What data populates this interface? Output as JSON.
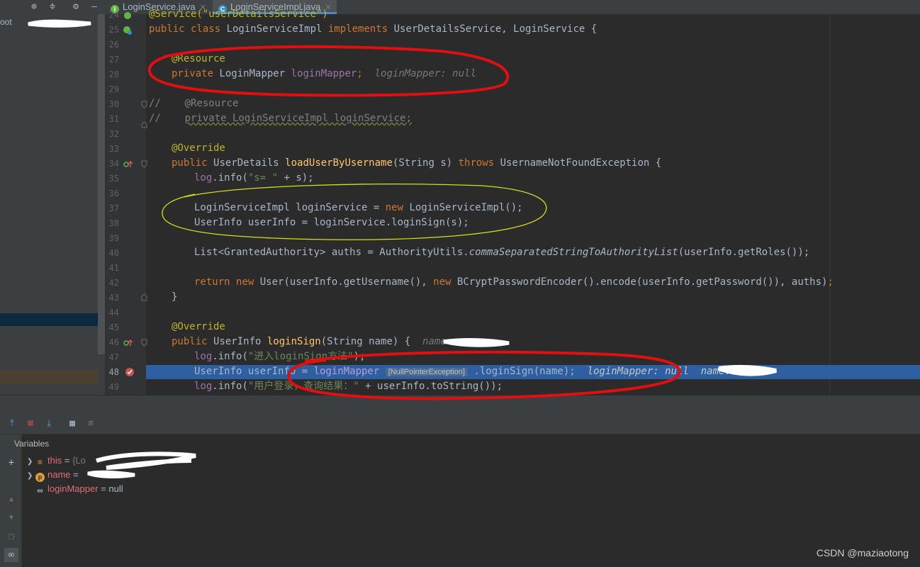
{
  "project_panel": {
    "root_label": "oot"
  },
  "tabs": [
    {
      "label": "LoginService.java",
      "icon_letter": "I",
      "icon_color": "#62b543"
    },
    {
      "label": "LoginServiceImpl.java",
      "icon_letter": "C",
      "icon_color": "#3592c4"
    }
  ],
  "line_numbers": [
    "24",
    "25",
    "26",
    "27",
    "28",
    "29",
    "30",
    "31",
    "32",
    "33",
    "34",
    "35",
    "36",
    "37",
    "38",
    "39",
    "40",
    "41",
    "42",
    "43",
    "44",
    "45",
    "46",
    "47",
    "48",
    "49"
  ],
  "code": {
    "l24": "@Service(\"userDetailsService\")",
    "l25_a": "public class ",
    "l25_b": "LoginServiceImpl ",
    "l25_c": "implements ",
    "l25_d": "UserDetailsService, LoginService {",
    "l27": "@Resource",
    "l28_kw": "private ",
    "l28_type": "LoginMapper ",
    "l28_field": "loginMapper",
    "l28_semi": ";",
    "l28_hint": "loginMapper: null",
    "l30_a": "//",
    "l30_b": "@Resource",
    "l31_a": "//",
    "l31_b": "private LoginServiceImpl loginService;",
    "l33": "@Override",
    "l34_a": "public ",
    "l34_b": "UserDetails ",
    "l34_c": "loadUserByUsername",
    "l34_d": "(String s) ",
    "l34_e": "throws ",
    "l34_f": "UsernameNotFoundException {",
    "l35_a": "log",
    "l35_b": ".info(",
    "l35_c": "\"s= \"",
    "l35_d": " + s);",
    "l37_a": "LoginServiceImpl loginService = ",
    "l37_b": "new ",
    "l37_c": "LoginServiceImpl();",
    "l38": "UserInfo userInfo = loginService.loginSign(s);",
    "l40_a": "List<GrantedAuthority> auths = AuthorityUtils.",
    "l40_b": "commaSeparatedStringToAuthorityList",
    "l40_c": "(userInfo.getRoles());",
    "l42_a": "return ",
    "l42_b": "new ",
    "l42_c": "User(userInfo.getUsername(), ",
    "l42_d": "new ",
    "l42_e": "BCryptPasswordEncoder().encode(userInfo.getPassword()), auths)",
    "l42_f": ";",
    "l43": "}",
    "l45": "@Override",
    "l46_a": "public ",
    "l46_b": "UserInfo ",
    "l46_c": "loginSign",
    "l46_d": "(String name) {",
    "l46_hint": "name: ",
    "l47_a": "log",
    "l47_b": ".info(",
    "l47_c": "\"进入loginSign方法\"",
    "l47_d": ");",
    "l48_a": "UserInfo userInfo = ",
    "l48_b": "loginMapper",
    "l48_exc": "[NullPointerException]",
    "l48_c": ".loginSign(name);",
    "l48_hint1": "loginMapper: null",
    "l48_hint2": "name: ",
    "l49_a": "log",
    "l49_b": ".info(",
    "l49_c": "\"用户登录，查询结果：\"",
    "l49_d": " + userInfo.toString());"
  },
  "debug": {
    "variables_title": "Variables",
    "vars": [
      {
        "name": "this",
        "eq": " = ",
        "value": "{Lo"
      },
      {
        "name": "name",
        "eq": " = ",
        "value": ""
      },
      {
        "name": "loginMapper",
        "eq": " = ",
        "value": "null"
      }
    ]
  },
  "watermark": "CSDN @maziaotong",
  "colors": {
    "exec_line": "#2d5fa1",
    "annotation_red": "#e01010",
    "annotation_yellow": "#d4e01a"
  }
}
